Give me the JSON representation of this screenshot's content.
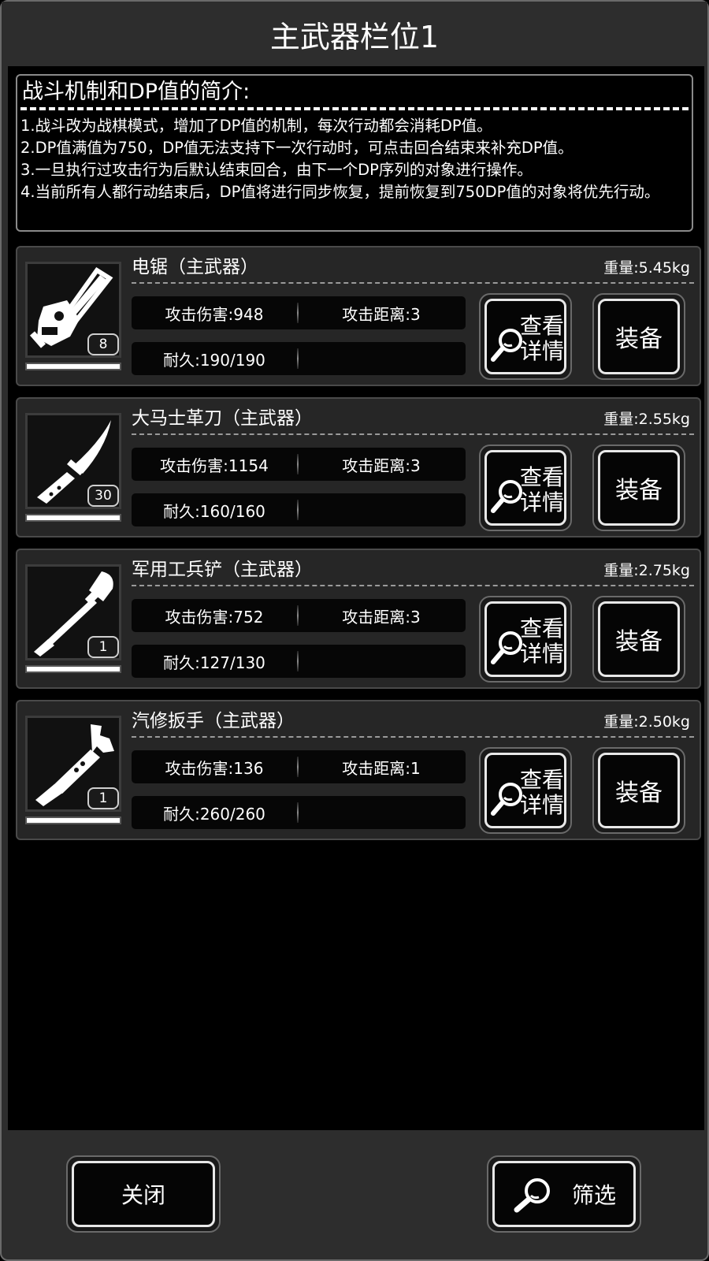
{
  "title": "主武器栏位1",
  "intro": {
    "heading": "战斗机制和DP值的简介:",
    "lines": [
      "1.战斗改为战棋模式，增加了DP值的机制，每次行动都会消耗DP值。",
      "2.DP值满值为750，DP值无法支持下一次行动时，可点击回合结束来补充DP值。",
      "3.一旦执行过攻击行为后默认结束回合，由下一个DP序列的对象进行操作。",
      "4.当前所有人都行动结束后，DP值将进行同步恢复，提前恢复到750DP值的对象将优先行动。"
    ]
  },
  "weapons": [
    {
      "name": "电锯（主武器）",
      "weight": "重量:5.45kg",
      "attack": "攻击伤害:948",
      "range": "攻击距离:3",
      "durability": "耐久:190/190",
      "count": "8",
      "durability_fraction": 1.0,
      "icon": "chainsaw-icon"
    },
    {
      "name": "大马士革刀（主武器）",
      "weight": "重量:2.55kg",
      "attack": "攻击伤害:1154",
      "range": "攻击距离:3",
      "durability": "耐久:160/160",
      "count": "30",
      "durability_fraction": 1.0,
      "icon": "knife-icon"
    },
    {
      "name": "军用工兵铲（主武器）",
      "weight": "重量:2.75kg",
      "attack": "攻击伤害:752",
      "range": "攻击距离:3",
      "durability": "耐久:127/130",
      "count": "1",
      "durability_fraction": 0.977,
      "icon": "shovel-icon"
    },
    {
      "name": "汽修扳手（主武器）",
      "weight": "重量:2.50kg",
      "attack": "攻击伤害:136",
      "range": "攻击距离:1",
      "durability": "耐久:260/260",
      "count": "1",
      "durability_fraction": 1.0,
      "icon": "wrench-icon"
    }
  ],
  "buttons": {
    "detail_line1": "查看",
    "detail_line2": "详情",
    "equip": "装备",
    "close": "关闭",
    "filter": "筛选"
  }
}
